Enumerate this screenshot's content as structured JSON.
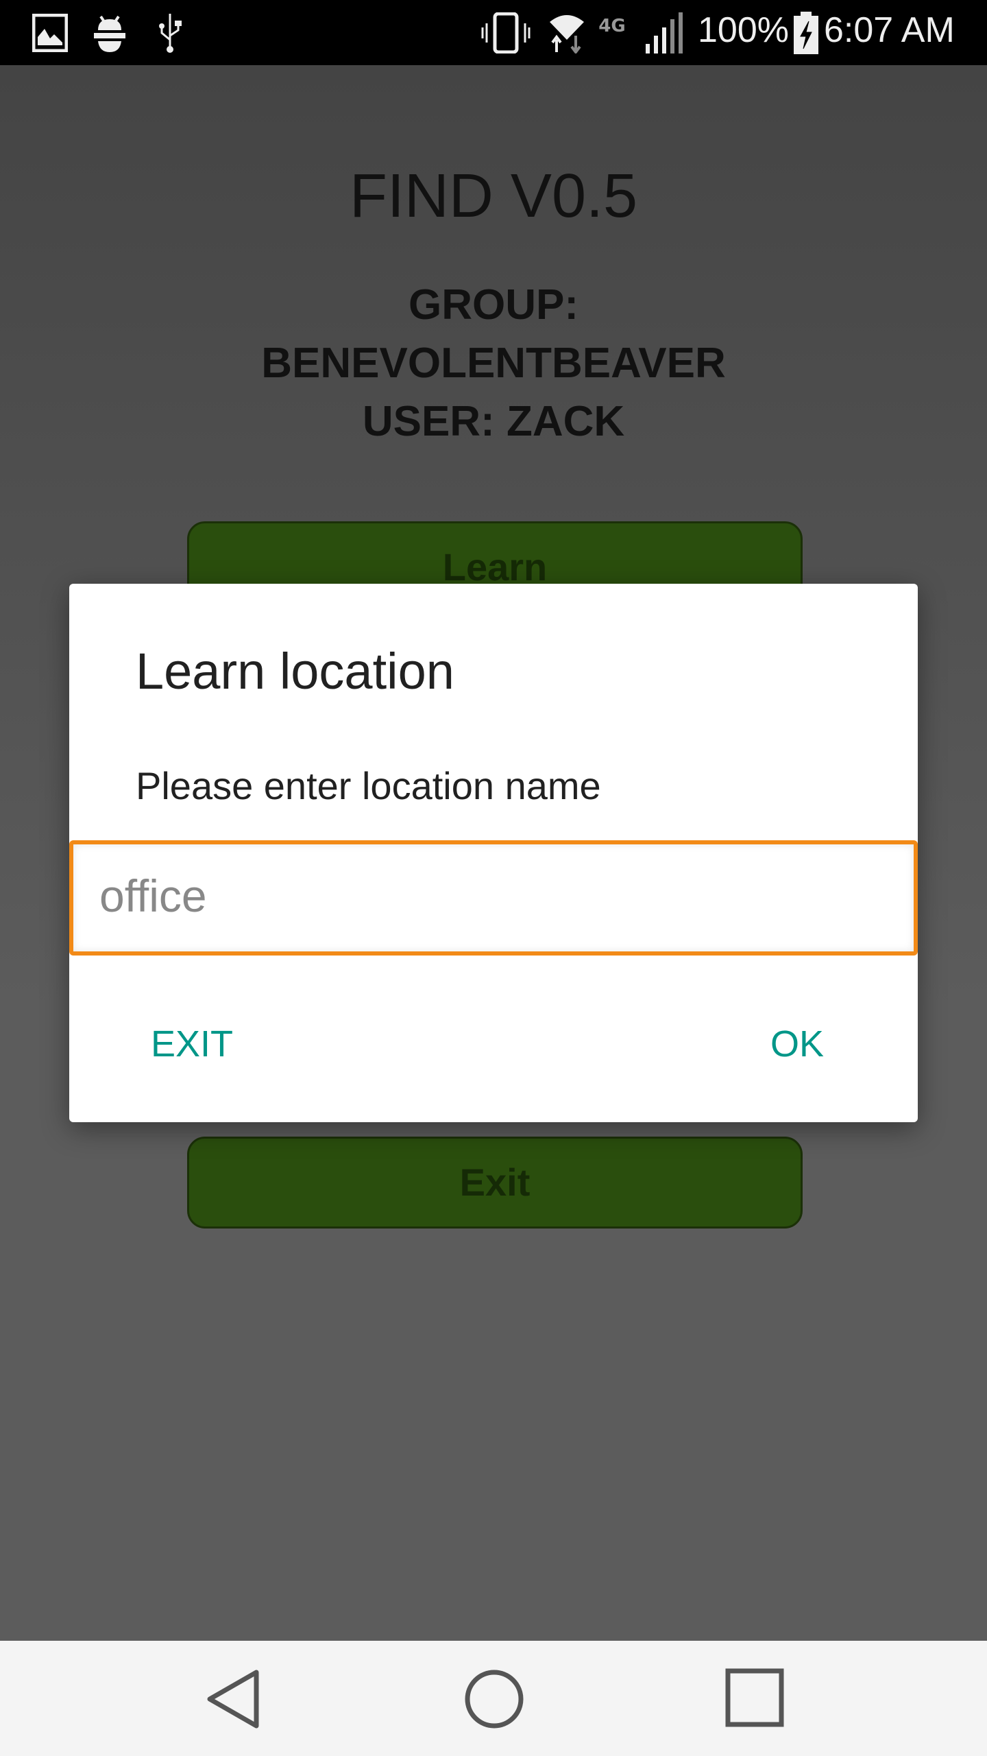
{
  "status_bar": {
    "left_icons": [
      "gallery-icon",
      "android-debug-icon",
      "usb-icon"
    ],
    "right_icons": [
      "vibrate-icon",
      "wifi-icon",
      "4g-lte-icon",
      "signal-icon",
      "battery-charging-icon"
    ],
    "battery": "100%",
    "time": "6:07 AM"
  },
  "app": {
    "title": "FIND V0.5",
    "group_line1": "GROUP:",
    "group_line2": "BENEVOLENTBEAVER",
    "user_line": "USER: ZACK",
    "learn_button": "Learn",
    "exit_button": "Exit",
    "button_color": "#2a4e0d"
  },
  "dialog": {
    "title": "Learn location",
    "message": "Please enter location name",
    "input_hint": "office",
    "exit_label": "EXIT",
    "ok_label": "OK",
    "accent": "#009688",
    "focus_color": "#f28a17"
  },
  "nav_bar": {
    "items": [
      "back-icon",
      "home-icon",
      "recents-icon"
    ]
  }
}
